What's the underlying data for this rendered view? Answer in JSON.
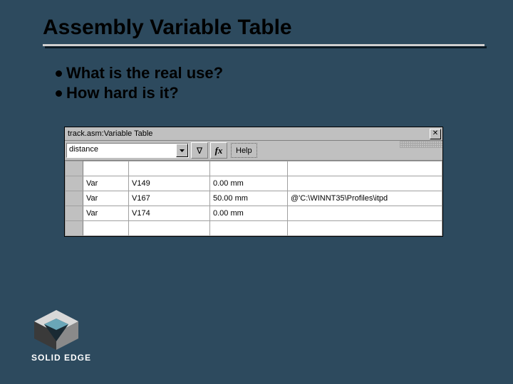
{
  "slide": {
    "title": "Assembly Variable Table",
    "bullets": [
      "What is the real use?",
      "How hard is it?"
    ]
  },
  "app": {
    "title": "track.asm:Variable Table",
    "close_glyph": "✕",
    "combo_value": "distance",
    "filter_glyph": "∇",
    "fx_label": "fx",
    "help_label": "Help",
    "rows": [
      {
        "type": "",
        "name": "",
        "value": "",
        "extra": ""
      },
      {
        "type": "Var",
        "name": "V149",
        "value": "0.00 mm",
        "extra": ""
      },
      {
        "type": "Var",
        "name": "V167",
        "value": "50.00 mm",
        "extra": "@'C:\\WINNT35\\Profiles\\itpd"
      },
      {
        "type": "Var",
        "name": "V174",
        "value": "0.00 mm",
        "extra": ""
      },
      {
        "type": "",
        "name": "",
        "value": "",
        "extra": ""
      }
    ]
  },
  "brand": {
    "text": "SOLID EDGE"
  }
}
